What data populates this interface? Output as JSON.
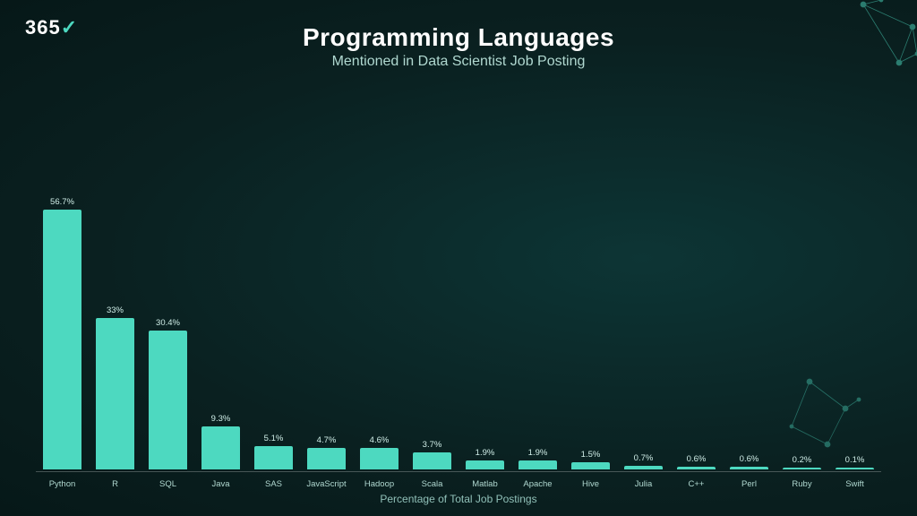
{
  "logo": {
    "text": "365",
    "check": "✓"
  },
  "title": "Programming Languages",
  "subtitle": "Mentioned in Data Scientist Job Posting",
  "xAxisLabel": "Percentage of Total Job Postings",
  "bars": [
    {
      "label": "Python",
      "value": 56.7,
      "display": "56.7%"
    },
    {
      "label": "R",
      "value": 33.0,
      "display": "33%"
    },
    {
      "label": "SQL",
      "value": 30.4,
      "display": "30.4%"
    },
    {
      "label": "Java",
      "value": 9.3,
      "display": "9.3%"
    },
    {
      "label": "SAS",
      "value": 5.1,
      "display": "5.1%"
    },
    {
      "label": "JavaScript",
      "value": 4.7,
      "display": "4.7%"
    },
    {
      "label": "Hadoop",
      "value": 4.6,
      "display": "4.6%"
    },
    {
      "label": "Scala",
      "value": 3.7,
      "display": "3.7%"
    },
    {
      "label": "Matlab",
      "value": 1.9,
      "display": "1.9%"
    },
    {
      "label": "Apache",
      "value": 1.9,
      "display": "1.9%"
    },
    {
      "label": "Hive",
      "value": 1.5,
      "display": "1.5%"
    },
    {
      "label": "Julia",
      "value": 0.7,
      "display": "0.7%"
    },
    {
      "label": "C++",
      "value": 0.6,
      "display": "0.6%"
    },
    {
      "label": "Perl",
      "value": 0.6,
      "display": "0.6%"
    },
    {
      "label": "Ruby",
      "value": 0.2,
      "display": "0.2%"
    },
    {
      "label": "Swift",
      "value": 0.1,
      "display": "0.1%"
    }
  ],
  "maxValue": 56.7,
  "chartHeight": 320
}
